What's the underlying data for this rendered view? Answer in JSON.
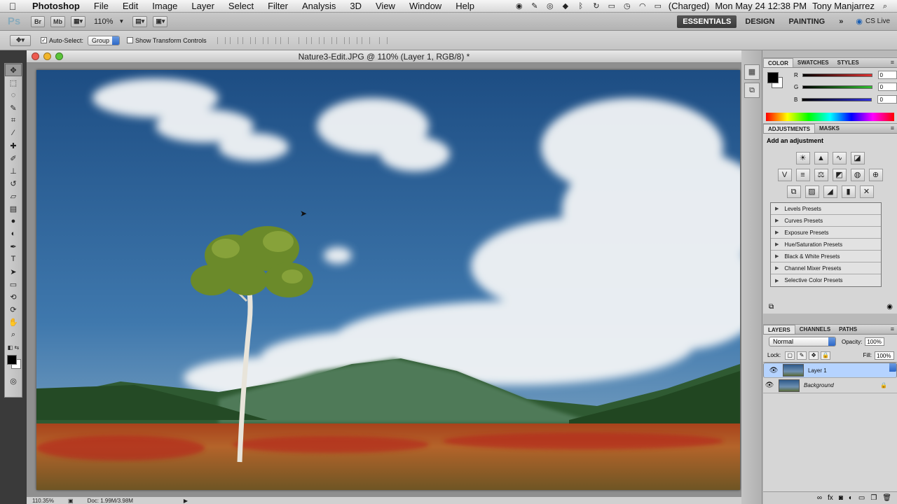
{
  "menubar": {
    "app_name": "Photoshop",
    "menus": [
      "File",
      "Edit",
      "Image",
      "Layer",
      "Select",
      "Filter",
      "Analysis",
      "3D",
      "View",
      "Window",
      "Help"
    ],
    "battery": "(Charged)",
    "clock": "Mon May 24  12:38 PM",
    "user": "Tony Manjarrez"
  },
  "appbar": {
    "logo": "Ps",
    "bridge_label": "Br",
    "minibridge_label": "Mb",
    "zoom": "110%",
    "workspaces": [
      "ESSENTIALS",
      "DESIGN",
      "PAINTING"
    ],
    "more": "»",
    "cs_live": "CS Live"
  },
  "options": {
    "auto_select_label": "Auto-Select:",
    "auto_select_value": "Group",
    "show_transform_label": "Show Transform Controls"
  },
  "document": {
    "title": "Nature3-Edit.JPG @ 110% (Layer 1, RGB/8) *",
    "zoom_status": "110.35%",
    "doc_status": "Doc: 1.99M/3.98M"
  },
  "color_panel": {
    "tabs": [
      "COLOR",
      "SWATCHES",
      "STYLES"
    ],
    "channels": [
      {
        "label": "R",
        "value": "0",
        "color": "#e03030"
      },
      {
        "label": "G",
        "value": "0",
        "color": "#30c030"
      },
      {
        "label": "B",
        "value": "0",
        "color": "#3030e0"
      }
    ]
  },
  "adjustments_panel": {
    "tabs": [
      "ADJUSTMENTS",
      "MASKS"
    ],
    "heading": "Add an adjustment",
    "presets": [
      "Levels Presets",
      "Curves Presets",
      "Exposure Presets",
      "Hue/Saturation Presets",
      "Black & White Presets",
      "Channel Mixer Presets",
      "Selective Color Presets"
    ]
  },
  "layers_panel": {
    "tabs": [
      "LAYERS",
      "CHANNELS",
      "PATHS"
    ],
    "blend_mode": "Normal",
    "opacity_label": "Opacity:",
    "opacity_value": "100%",
    "lock_label": "Lock:",
    "fill_label": "Fill:",
    "fill_value": "100%",
    "layers": [
      {
        "name": "Layer 1",
        "selected": true
      },
      {
        "name": "Background",
        "selected": false
      }
    ]
  }
}
